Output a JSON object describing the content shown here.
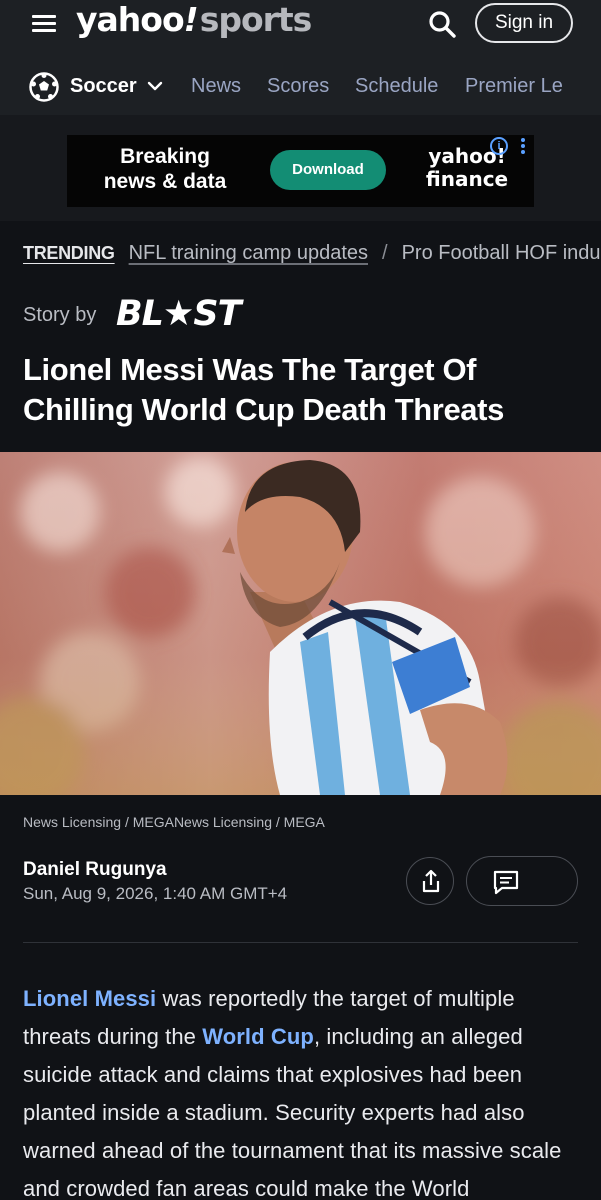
{
  "header": {
    "logo_main": "yahoo",
    "logo_bang": "!",
    "logo_section": "sports",
    "signin_label": "Sign in"
  },
  "nav": {
    "current": "Soccer",
    "links": [
      "News",
      "Scores",
      "Schedule",
      "Premier Le"
    ]
  },
  "ad": {
    "headline": "Breaking news & data",
    "cta": "Download",
    "brand": "yahoo! finance",
    "info": "i"
  },
  "trending": {
    "label": "TRENDING",
    "items": [
      "NFL training camp updates",
      "Pro Football HOF inductions"
    ],
    "separator": "/"
  },
  "story": {
    "by_label": "Story by",
    "publisher": "BL★ST",
    "headline": "Lionel Messi Was The Target Of Chilling World Cup Death Threats",
    "image_credit": "News Licensing / MEGANews Licensing / MEGA",
    "author": "Daniel Rugunya",
    "date": "Sun, Aug 9, 2026, 1:40 AM GMT+4"
  },
  "body": {
    "link1": "Lionel Messi",
    "text1": " was reportedly the target of multiple threats during the ",
    "link2": "World Cup",
    "text2": ", including an alleged suicide attack and claims that explosives had been planted inside a stadium. Security experts had also warned ahead of the tournament that its massive scale and crowded fan areas could make the World"
  },
  "colors": {
    "header_bg": "#1d2024",
    "page_bg": "#101216",
    "link": "#7eb2ff",
    "nav_link": "#9aa5c3",
    "ad_button": "#138d74"
  },
  "icons": [
    "hamburger-icon",
    "search-icon",
    "soccer-ball-icon",
    "chevron-down-icon",
    "info-icon",
    "more-vert-icon",
    "share-icon",
    "comment-icon"
  ]
}
